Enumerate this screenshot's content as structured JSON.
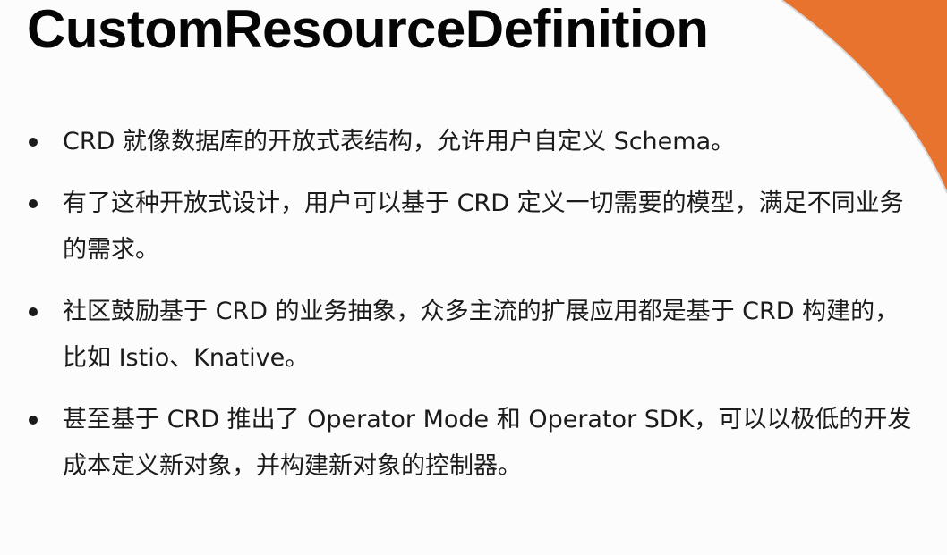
{
  "slide": {
    "title": "CustomResourceDefinition",
    "accent_color": "#e8732f",
    "bullet_icon": "bullet-dot",
    "bullets": [
      {
        "text": "CRD 就像数据库的开放式表结构，允许用户自定义 Schema。"
      },
      {
        "text": "有了这种开放式设计，用户可以基于 CRD 定义一切需要的模型，满足不同业务的需求。"
      },
      {
        "text": "社区鼓励基于 CRD 的业务抽象，众多主流的扩展应用都是基于 CRD 构建的，比如 Istio、Knative。"
      },
      {
        "text": "甚至基于 CRD 推出了 Operator Mode 和 Operator SDK，可以以极低的开发成本定义新对象，并构建新对象的控制器。"
      }
    ]
  }
}
